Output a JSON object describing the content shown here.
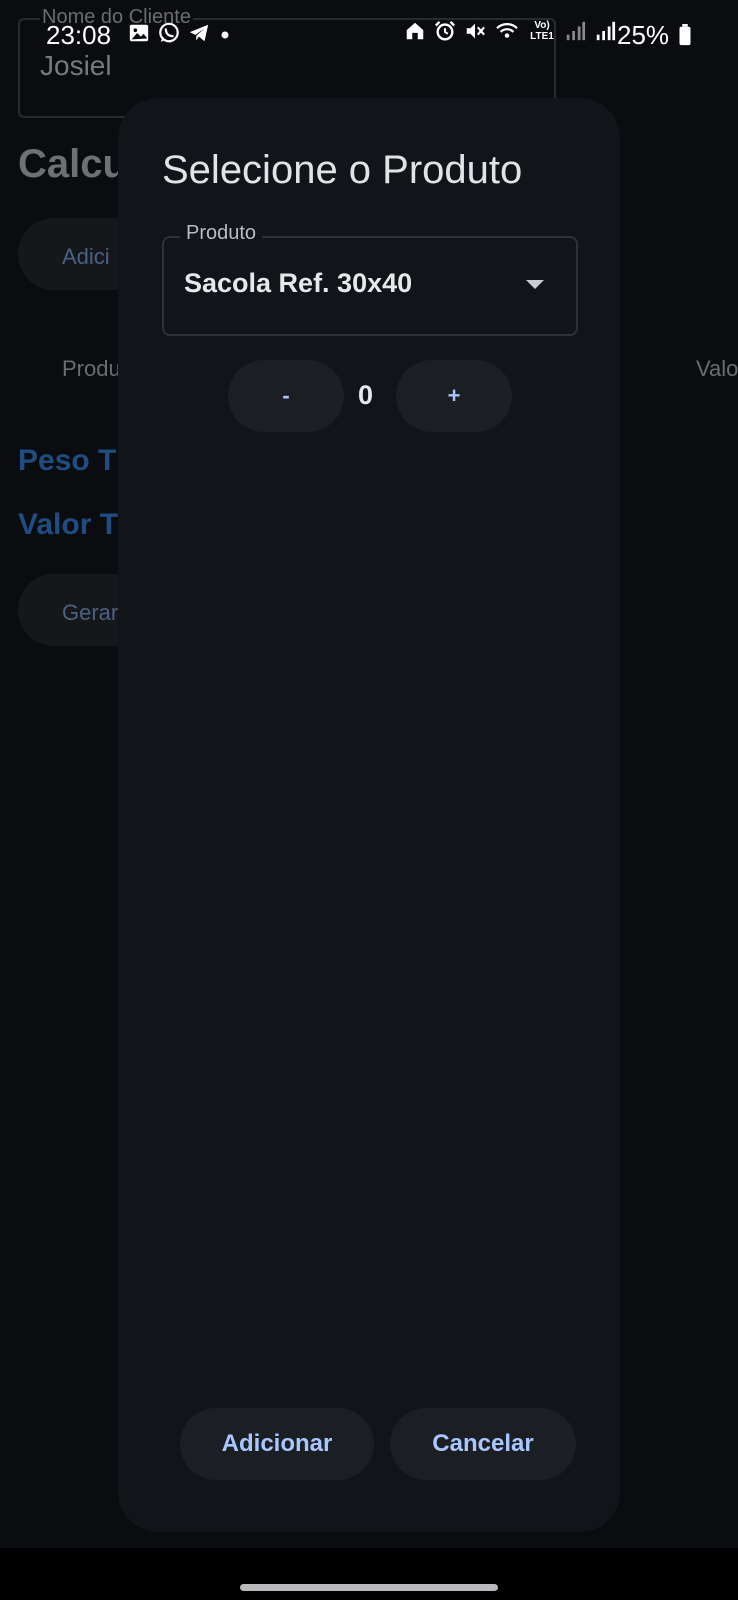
{
  "status_bar": {
    "time": "23:08",
    "battery": "25%",
    "network_label": "Vo) LTE1",
    "left_icons": [
      "gallery-icon",
      "whatsapp-icon",
      "telegram-icon",
      "dot-icon"
    ],
    "right_icons": [
      "home-icon",
      "alarm-icon",
      "mute-icon",
      "wifi-icon",
      "volte-icon",
      "signal-icon",
      "signal-icon",
      "battery-icon"
    ]
  },
  "background_app": {
    "client_field": {
      "label": "Nome do Cliente",
      "value": "Josiel"
    },
    "heading": "Calcu",
    "add_button": "Adici",
    "columns": {
      "product": "Produ",
      "value": "Valo"
    },
    "total_weight": "Peso T",
    "total_value": "Valor T",
    "generate_button": "Gerar"
  },
  "dialog": {
    "title": "Selecione o Produto",
    "product_field": {
      "label": "Produto",
      "value": "Sacola Ref. 30x40"
    },
    "quantity": {
      "minus_label": "-",
      "value": "0",
      "plus_label": "+"
    },
    "add_label": "Adicionar",
    "cancel_label": "Cancelar"
  },
  "colors": {
    "dialog_bg": "#111418",
    "button_text": "#a9c7ff",
    "background_accent": "#1f4d82"
  }
}
